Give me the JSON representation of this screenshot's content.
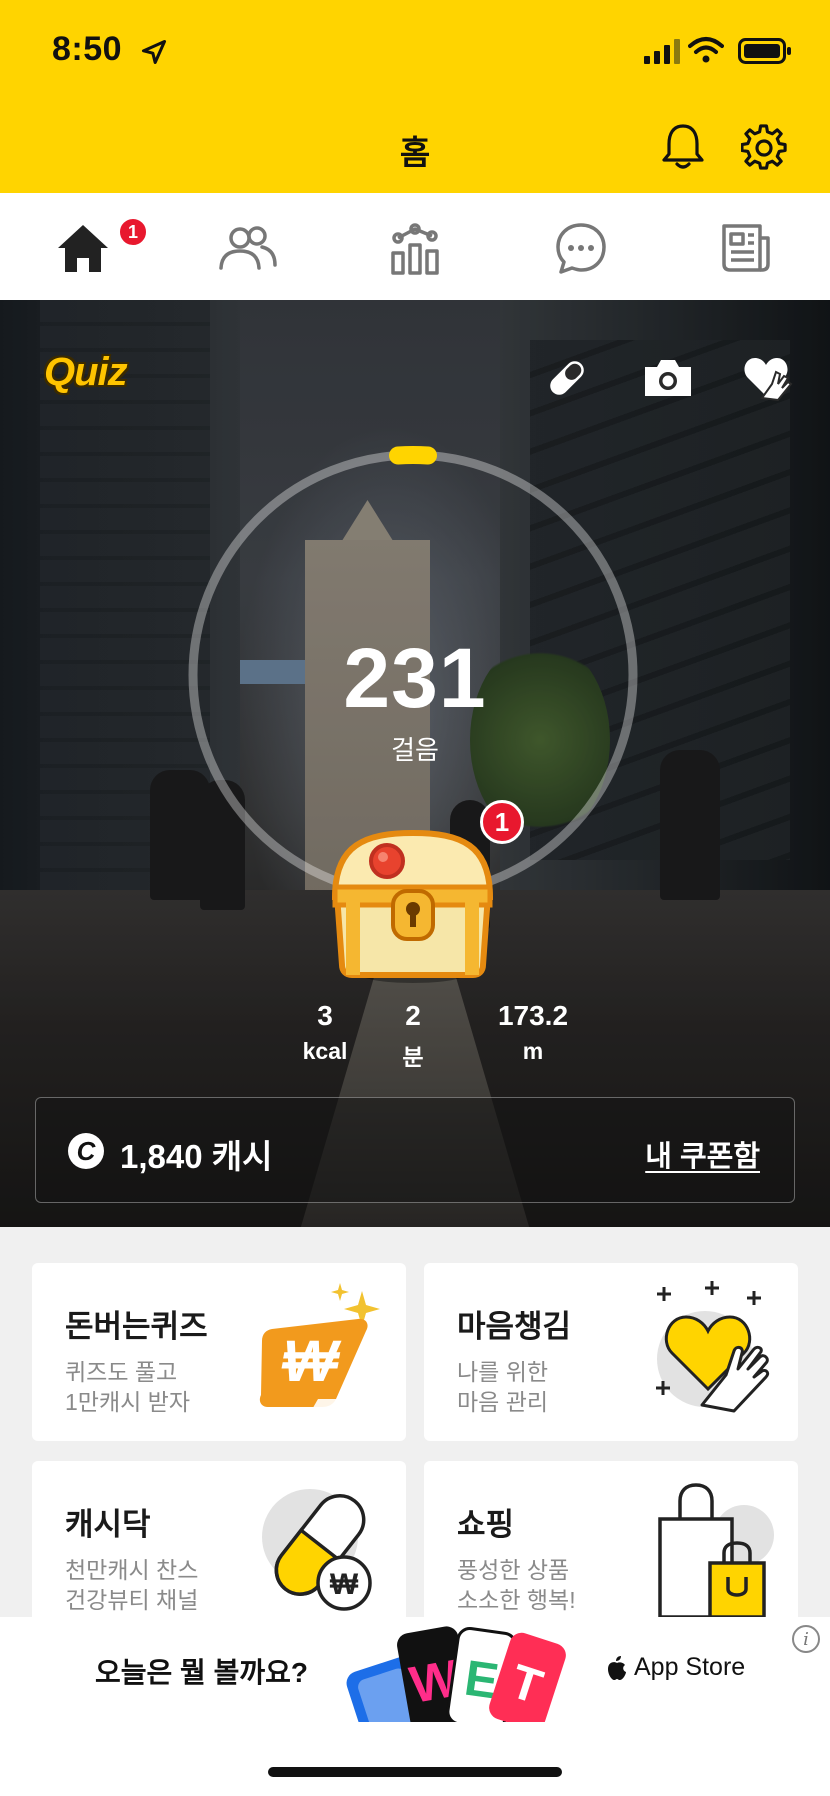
{
  "status_bar": {
    "time": "8:50"
  },
  "header": {
    "title": "홈"
  },
  "tabs": {
    "home_badge": "1",
    "items": [
      {
        "icon": "home-icon",
        "active": true
      },
      {
        "icon": "friends-icon",
        "active": false
      },
      {
        "icon": "stats-icon",
        "active": false
      },
      {
        "icon": "chat-icon",
        "active": false
      },
      {
        "icon": "news-icon",
        "active": false
      }
    ]
  },
  "hero": {
    "quiz_label": "Quiz",
    "steps": "231",
    "steps_label": "걸음",
    "chest_badge": "1",
    "stats": [
      {
        "value": "3",
        "unit": "kcal"
      },
      {
        "value": "2",
        "unit": "분"
      },
      {
        "value": "173.2",
        "unit": "m"
      }
    ],
    "cash": {
      "icon_letter": "C",
      "amount": "1,840 캐시",
      "coupon_link": "내 쿠폰함"
    }
  },
  "cards": [
    {
      "title": "돈버는퀴즈",
      "line1": "퀴즈도 풀고",
      "line2": "1만캐시 받자",
      "icon": "coin-sparkle-icon"
    },
    {
      "title": "마음챙김",
      "line1": "나를 위한",
      "line2": "마음 관리",
      "icon": "heart-hand-icon"
    },
    {
      "title": "캐시닥",
      "line1": "천만캐시 찬스",
      "line2": "건강뷰티 채널",
      "icon": "pill-icon"
    },
    {
      "title": "쇼핑",
      "line1": "풍성한 상품",
      "line2": "소소한 행복!",
      "icon": "shopping-bag-icon"
    }
  ],
  "ad": {
    "text": "오늘은 뭘 볼까요?",
    "store_label": "App Store",
    "info": "i"
  },
  "colors": {
    "brand_yellow": "#FFD400",
    "badge_red": "#E8182E",
    "orange": "#F29A1D"
  }
}
